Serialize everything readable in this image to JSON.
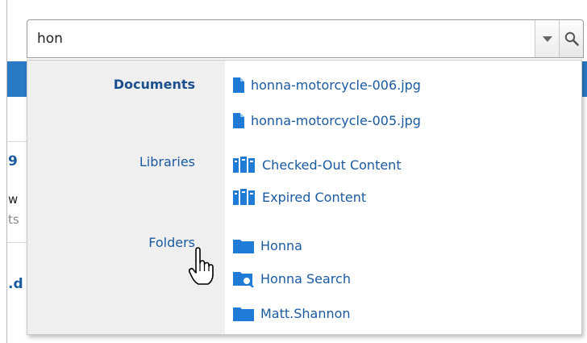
{
  "search": {
    "value": "hon"
  },
  "background": {
    "fragments": [
      "9",
      "w",
      "ts",
      ".d"
    ]
  },
  "suggestions": {
    "groups": [
      {
        "label": "Documents",
        "items": [
          "honna-motorcycle-006.jpg",
          "honna-motorcycle-005.jpg"
        ],
        "icon": "document-icon"
      },
      {
        "label": "Libraries",
        "items": [
          "Checked-Out Content",
          "Expired Content"
        ],
        "icon": "library-icon"
      },
      {
        "label": "Folders",
        "items": [
          "Honna",
          "Honna Search",
          "Matt.Shannon"
        ],
        "icon": "folder-icon"
      }
    ]
  },
  "colors": {
    "link": "#1a5aa0",
    "icon_blue": "#1f7bd6",
    "panel_grey": "#efefef",
    "header_blue": "#2a7ac7"
  }
}
